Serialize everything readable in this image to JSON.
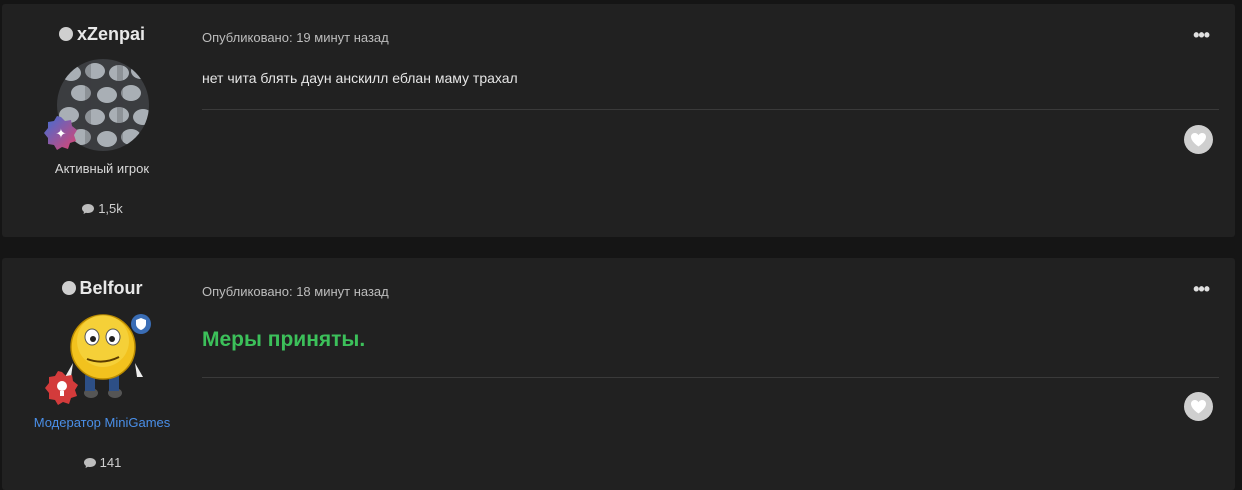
{
  "posts": [
    {
      "author": "xZenpai",
      "group": "Активный игрок",
      "group_color": "#d9d9d9",
      "post_count": "1,5k",
      "meta": "Опубликовано: 19 минут назад",
      "content": "нет чита блять даун анскилл еблан маму трахал",
      "menu_label": "•••"
    },
    {
      "author": "Belfour",
      "group": "Модератор MiniGames",
      "group_color": "#4a8fe8",
      "post_count": "141",
      "meta": "Опубликовано: 18 минут назад",
      "content": "Меры приняты.",
      "content_color": "#3cc05a",
      "menu_label": "•••"
    }
  ]
}
